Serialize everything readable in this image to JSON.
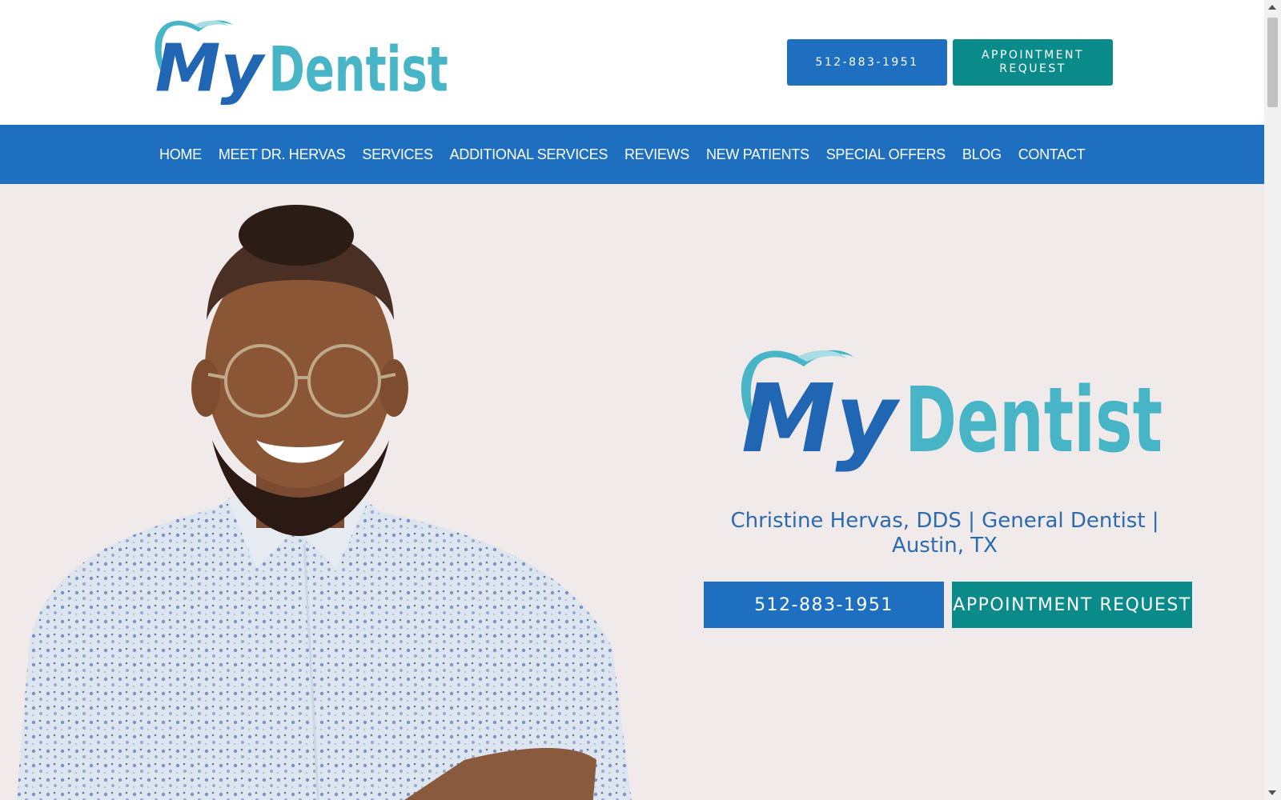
{
  "header": {
    "logo": {
      "icon": "tooth-logo-icon",
      "text_my": "My",
      "text_dentist": "Dentist"
    },
    "phone_label": "512-883-1951",
    "appointment_label": "APPOINTMENT REQUEST"
  },
  "nav": {
    "items": [
      {
        "label": "HOME"
      },
      {
        "label": "MEET DR. HERVAS"
      },
      {
        "label": "SERVICES"
      },
      {
        "label": "ADDITIONAL SERVICES"
      },
      {
        "label": "REVIEWS"
      },
      {
        "label": "NEW PATIENTS"
      },
      {
        "label": "SPECIAL OFFERS"
      },
      {
        "label": "BLOG"
      },
      {
        "label": "CONTACT"
      }
    ]
  },
  "hero": {
    "logo": {
      "icon": "tooth-logo-icon",
      "text_my": "My",
      "text_dentist": "Dentist"
    },
    "tagline": "Christine Hervas, DDS | General Dentist | Austin, TX",
    "phone_label": "512-883-1951",
    "appointment_label": "APPOINTMENT REQUEST"
  },
  "colors": {
    "brand_blue": "#1e6fbf",
    "brand_teal": "#0b8a8a",
    "logo_dark_blue": "#2166b3",
    "logo_light_teal": "#47b5c6",
    "hero_background": "#f0ebea"
  }
}
